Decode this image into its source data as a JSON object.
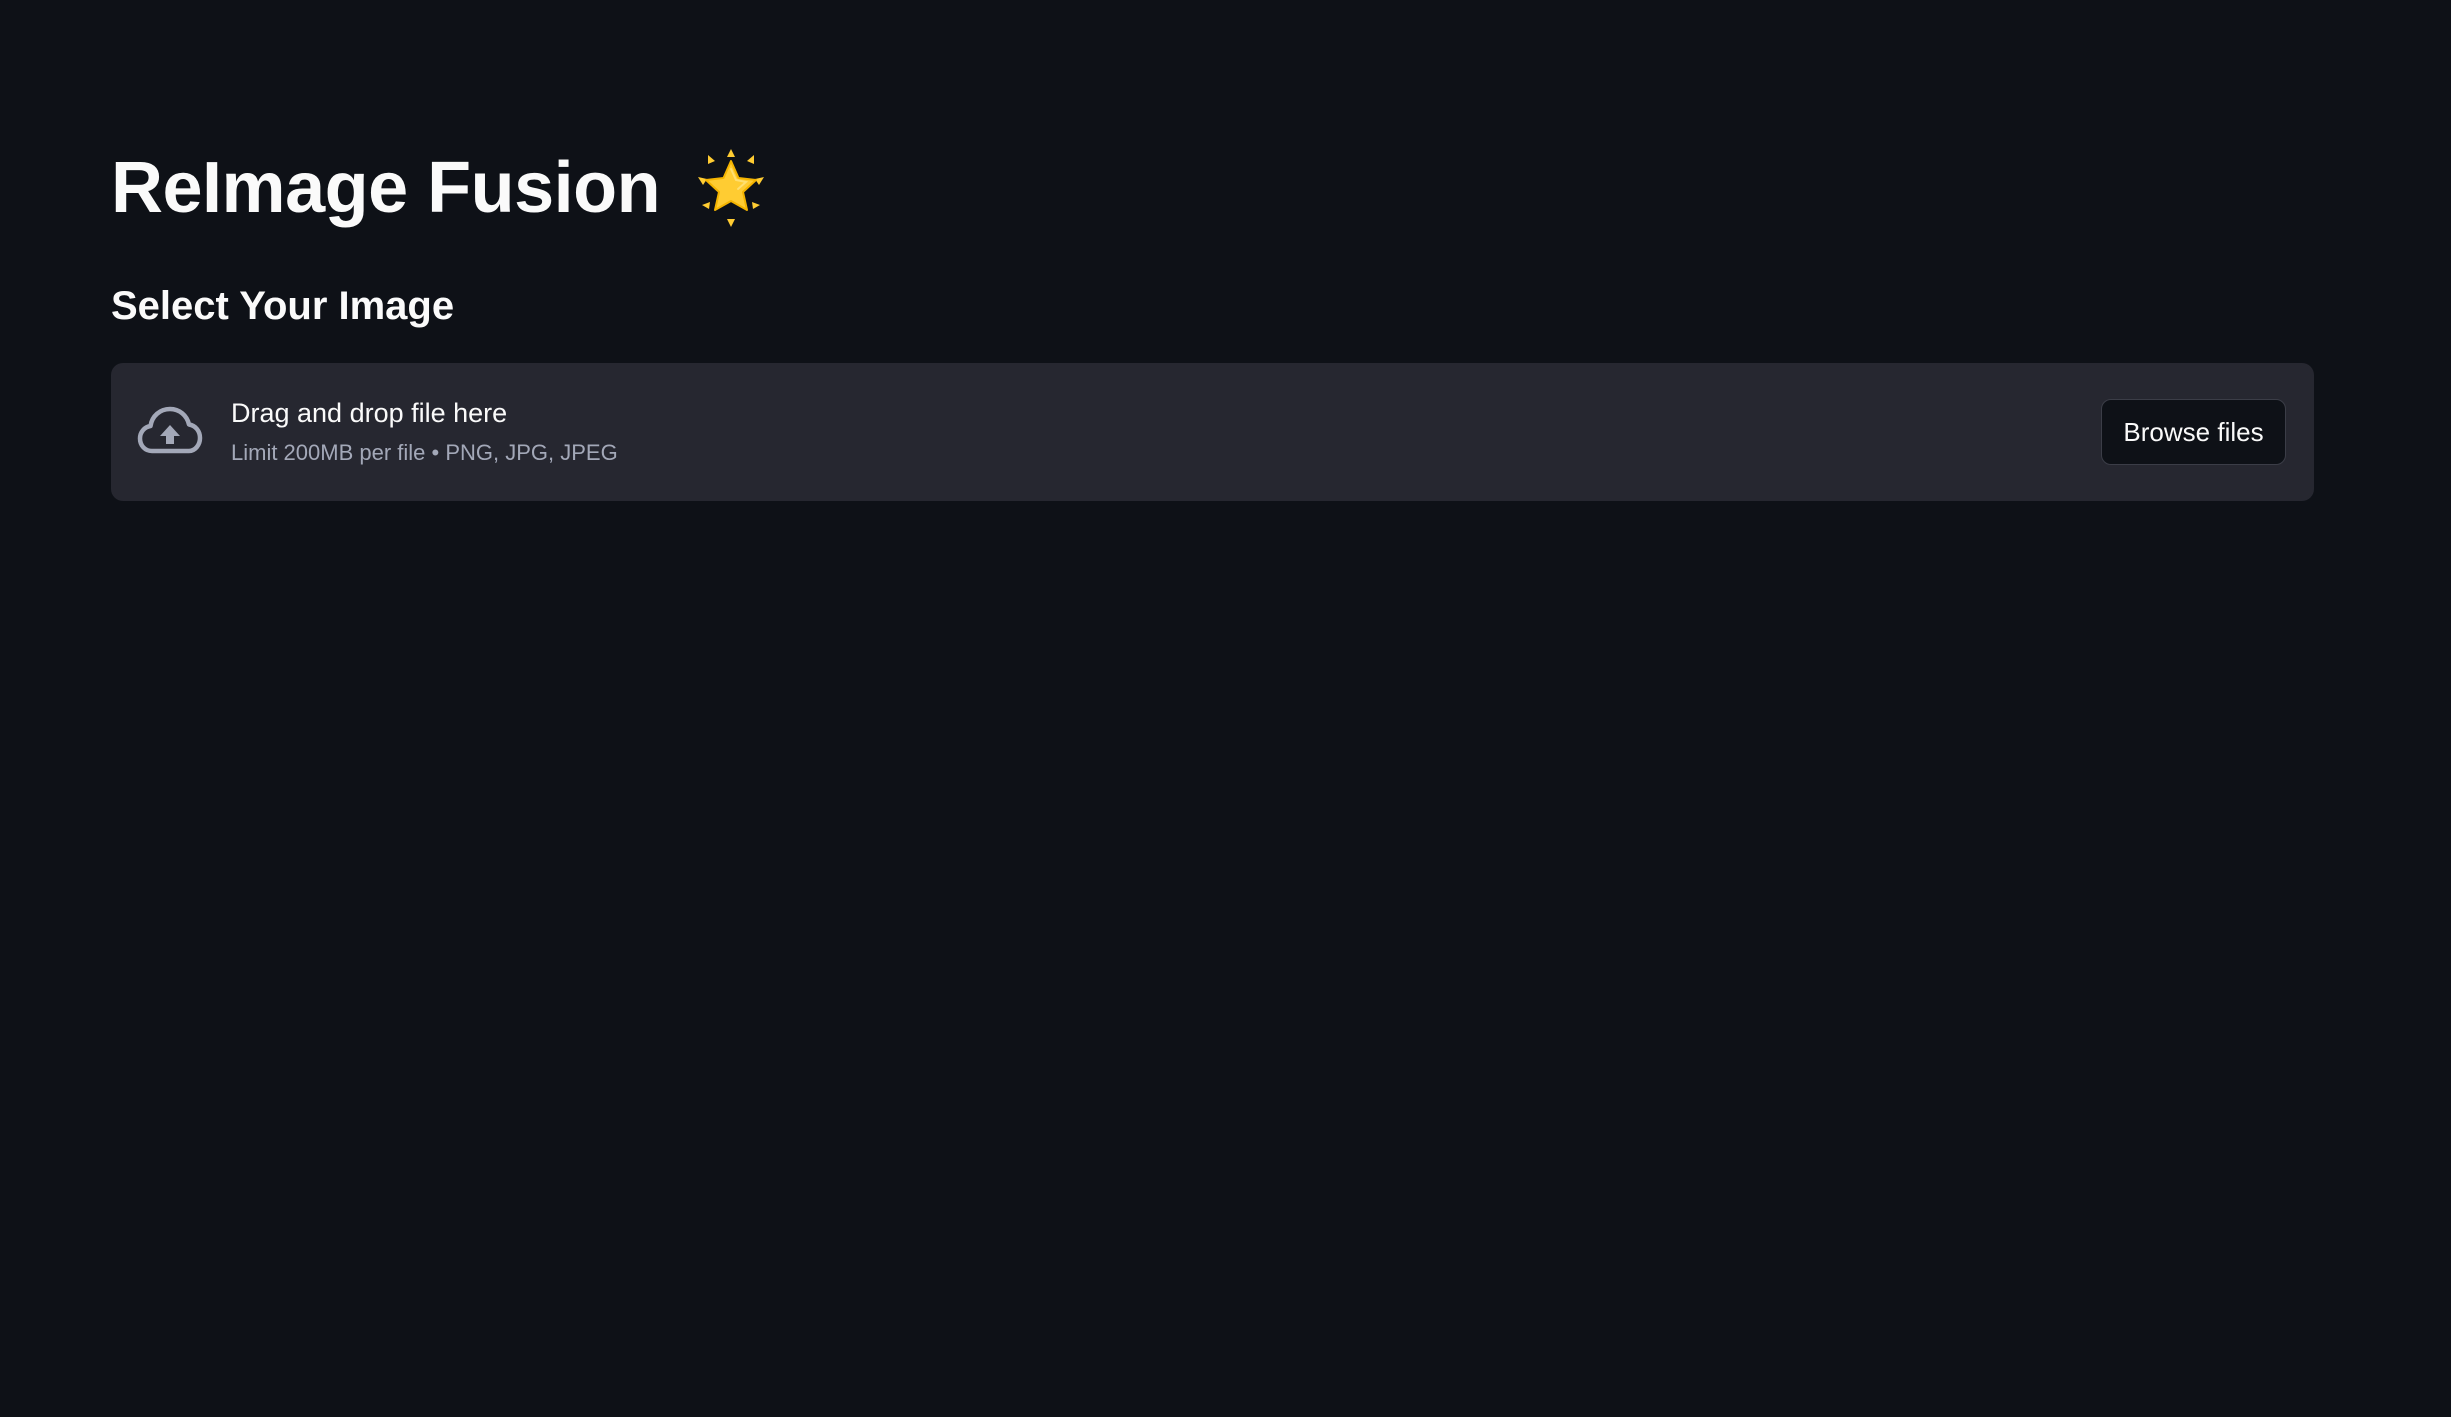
{
  "app": {
    "title": "ReImage Fusion",
    "title_emoji_icon": "glowing-star-icon"
  },
  "main": {
    "subheader": "Select Your Image",
    "uploader": {
      "icon": "cloud-upload-icon",
      "instructions": "Drag and drop file here",
      "limit_text": "Limit 200MB per file • PNG, JPG, JPEG",
      "browse_label": "Browse files"
    }
  },
  "colors": {
    "background": "#0e1117",
    "dropzone_bg": "#262730",
    "text_primary": "#fafafa",
    "text_secondary": "#a3a8b8",
    "star_yellow": "#ffcc32"
  }
}
